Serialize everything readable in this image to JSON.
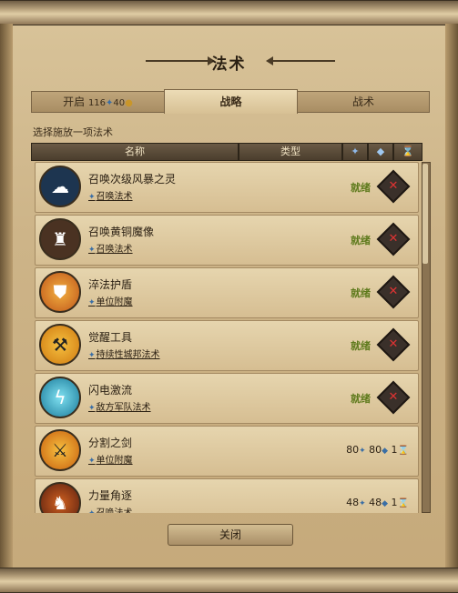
{
  "window": {
    "title": "法术"
  },
  "tabs": [
    {
      "label": "开启",
      "mana": "116",
      "gold": "40"
    },
    {
      "label": "战略"
    },
    {
      "label": "战术"
    }
  ],
  "prompt": "选择施放一项法术",
  "columns": {
    "name": "名称",
    "type": "类型",
    "mana_icon": "mana-icon",
    "diamond_icon": "diamond-icon",
    "hourglass_icon": "hourglass-icon"
  },
  "spells": [
    {
      "name": "召唤次级风暴之灵",
      "type": "召唤法术",
      "status": "就绪",
      "icon": "storm-spirit-icon",
      "color": "#3a6ea5"
    },
    {
      "name": "召唤黄铜魔像",
      "type": "召唤法术",
      "status": "就绪",
      "icon": "brass-golem-icon",
      "color": "#6b4a2a"
    },
    {
      "name": "淬法护盾",
      "type": "单位附魔",
      "status": "就绪",
      "icon": "shield-icon",
      "color": "#d97a1a"
    },
    {
      "name": "觉醒工具",
      "type": "持续性城邦法术",
      "status": "就绪",
      "icon": "hammer-pick-icon",
      "color": "#e0901a"
    },
    {
      "name": "闪电激流",
      "type": "敌方军队法术",
      "status": "就绪",
      "icon": "lightning-icon",
      "color": "#2ea3c4"
    },
    {
      "name": "分割之剑",
      "type": "单位附魔",
      "mana": "80",
      "diamond": "80",
      "turns": "1",
      "icon": "sword-icon",
      "color": "#e08a1a"
    },
    {
      "name": "力量角逐",
      "type": "召唤法术",
      "mana": "48",
      "diamond": "48",
      "turns": "1",
      "icon": "warrior-icon",
      "color": "#a04418"
    }
  ],
  "close_label": "关闭"
}
